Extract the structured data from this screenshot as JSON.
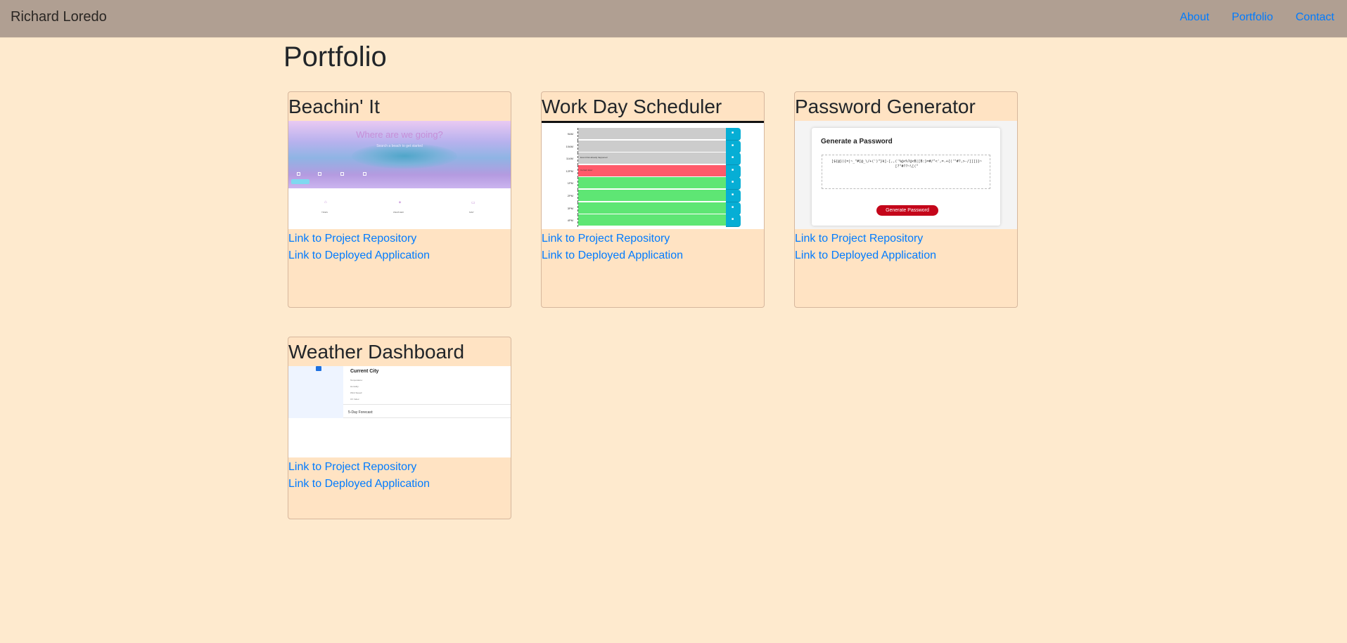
{
  "nav": {
    "brand": "Richard Loredo",
    "links": [
      "About",
      "Portfolio",
      "Contact"
    ]
  },
  "page": {
    "title": "Portfolio"
  },
  "projects": [
    {
      "title": "Beachin' It",
      "repo_link": "Link to Project Repository",
      "deploy_link": "Link to Deployed Application",
      "screenshot": {
        "heading": "Where are we going?",
        "sub": "Search a beach to get started",
        "tabs": [
          "TIDES",
          "WEATHER",
          "MAP"
        ],
        "icons": [
          "tides-icon",
          "weather-icon",
          "map-icon"
        ]
      }
    },
    {
      "title": "Work Day Scheduler",
      "repo_link": "Link to Project Repository",
      "deploy_link": "Link to Deployed Application",
      "screenshot": {
        "hours": [
          "9AM",
          "10AM",
          "11AM",
          "12PM",
          "1PM",
          "2PM",
          "3PM",
          "4PM"
        ],
        "notes": [
          "",
          "",
          "Event that already happened",
          "Current Hour",
          "",
          "",
          "",
          ""
        ],
        "row_colors": [
          "#cccccc",
          "#cccccc",
          "#cccccc",
          "#ff5a6a",
          "#5ee674",
          "#5ee674",
          "#5ee674",
          "#5ee674"
        ],
        "save_icon": "lock-icon"
      }
    },
    {
      "title": "Password Generator",
      "repo_link": "Link to Project Repository",
      "deploy_link": "Link to Deployed Application",
      "screenshot": {
        "heading": "Generate a Password",
        "password": "]${@}){=|~_\"#[@_\\/+(')\"}k]-[,,('%@<%?@<B|[B:}=#/^<',=.+{('\"#?,>-/]]]}}~[?\"#??~\\[(\"",
        "button": "Generate Password"
      }
    },
    {
      "title": "Weather Dashboard",
      "repo_link": "Link to Project Repository",
      "deploy_link": "Link to Deployed Application",
      "screenshot": {
        "heading": "Current City",
        "fields": [
          "Temperature:",
          "Humidity:",
          "Wind Speed:",
          "UV Index:"
        ],
        "forecast": "5-Day Forecast:"
      }
    }
  ],
  "colors": {
    "page_bg": "#feeace",
    "navbar_bg": "#b09f92",
    "card_bg": "#ffe3c3",
    "link": "#007bff"
  }
}
